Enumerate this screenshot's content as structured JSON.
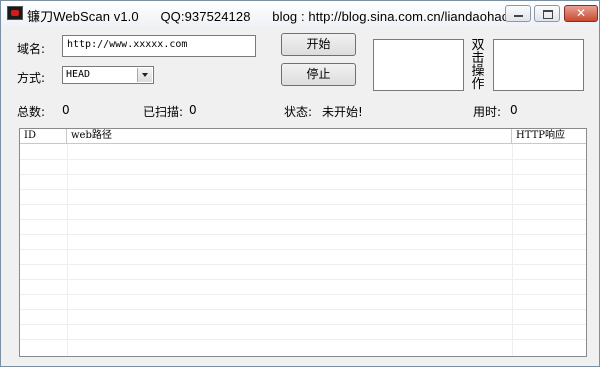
{
  "window": {
    "app_name": "镰刀WebScan v1.0",
    "qq": "QQ:937524128",
    "blog": "blog : http://blog.sina.com.cn/liandaohack"
  },
  "form": {
    "domain_label": "域名:",
    "domain_value": "http://www.xxxxx.com",
    "method_label": "方式:",
    "method_value": "HEAD",
    "start_button": "开始",
    "stop_button": "停止",
    "vertical_label": "双击操作"
  },
  "status": {
    "total_label": "总数:",
    "total_value": "0",
    "scanned_label": "已扫描:",
    "scanned_value": "0",
    "state_label": "状态:",
    "state_value": "未开始!",
    "time_label": "用时:",
    "time_value": "0"
  },
  "table": {
    "columns": [
      "ID",
      "web路径",
      "HTTP响应"
    ],
    "rows": []
  },
  "icons": {
    "app_icon": "app-logo-icon",
    "minimize": "minimize-icon",
    "maximize": "maximize-icon",
    "close": "close-icon",
    "dropdown": "chevron-down-icon"
  }
}
